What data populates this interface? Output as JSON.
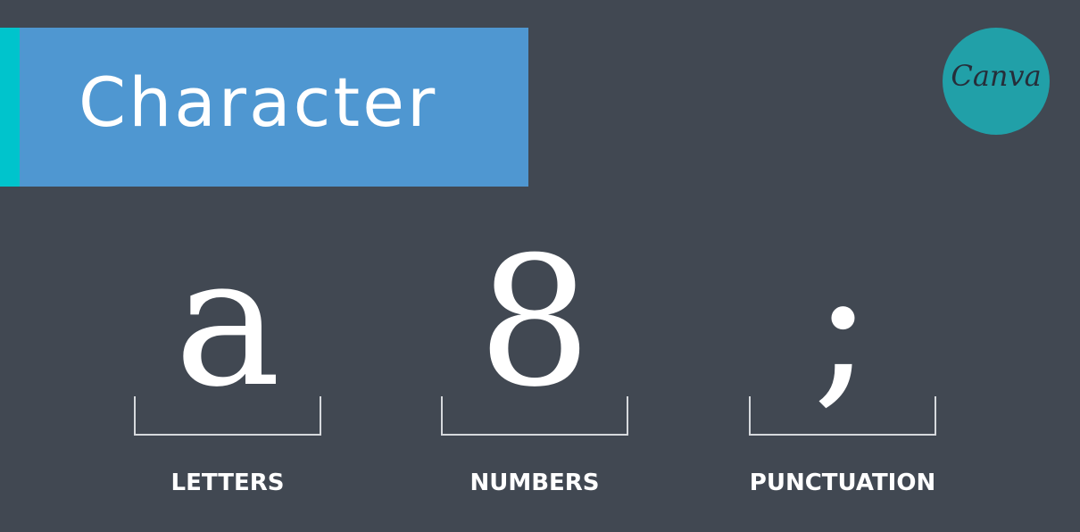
{
  "title": {
    "text": "Character"
  },
  "logo": {
    "text": "Canva"
  },
  "examples": [
    {
      "glyph": "a",
      "label": "LETTERS"
    },
    {
      "glyph": "8",
      "label": "NUMBERS"
    },
    {
      "glyph": ";",
      "label": "PUNCTUATION"
    }
  ],
  "colors": {
    "background": "#414852",
    "banner": "#4f97d1",
    "banner_accent": "#00c4cc",
    "logo_badge": "#21a0a8",
    "text": "#ffffff"
  }
}
